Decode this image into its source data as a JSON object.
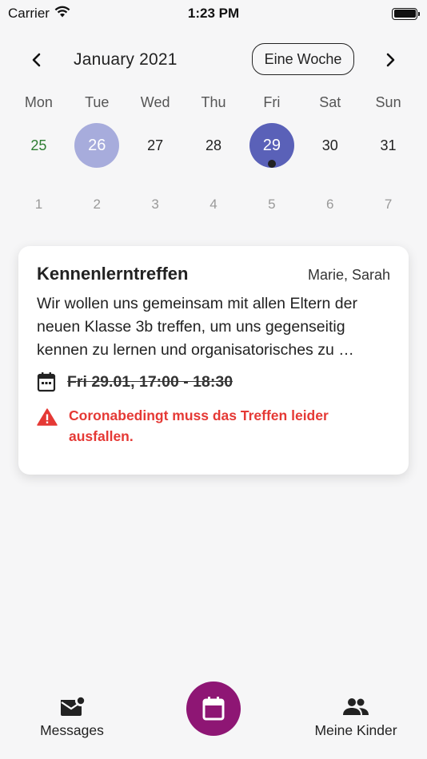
{
  "status_bar": {
    "carrier": "Carrier",
    "time": "1:23 PM"
  },
  "header": {
    "prev_icon": "chevron-left-icon",
    "month": "January 2021",
    "week_toggle": "Eine Woche",
    "next_icon": "chevron-right-icon"
  },
  "calendar": {
    "weekdays": [
      "Mon",
      "Tue",
      "Wed",
      "Thu",
      "Fri",
      "Sat",
      "Sun"
    ],
    "week1": [
      "25",
      "26",
      "27",
      "28",
      "29",
      "30",
      "31"
    ],
    "week2": [
      "1",
      "2",
      "3",
      "4",
      "5",
      "6",
      "7"
    ],
    "today": "25",
    "selected": "29",
    "highlighted": "26",
    "today_color": "#2e7d32",
    "selected_color": "#5a61b8",
    "highlight_color": "#a7acdc"
  },
  "event": {
    "title": "Kennenlerntreffen",
    "participants": "Marie, Sarah",
    "description": "Wir wollen uns gemeinsam mit allen Eltern der neuen Klasse 3b treffen, um uns gegenseitig kennen zu lernen und organisatorisches zu …",
    "datetime": "Fri 29.01, 17:00 - 18:30",
    "warning": "Coronabedingt muss das Treffen leider ausfallen.",
    "warning_color": "#e53935"
  },
  "bottom_nav": {
    "messages_label": "Messages",
    "kids_label": "Meine Kinder",
    "fab_icon": "calendar-icon",
    "fab_color": "#8e1674"
  }
}
